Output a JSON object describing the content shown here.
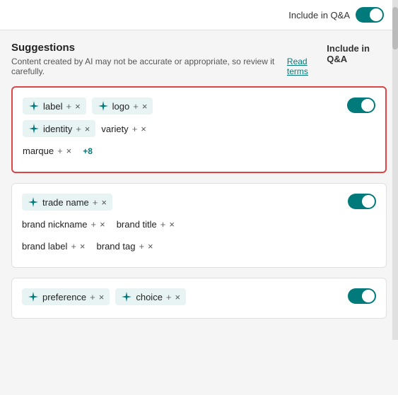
{
  "topbar": {
    "toggle_label": "Include in Q&A",
    "toggle_on": true
  },
  "header": {
    "suggestions_title": "Suggestions",
    "suggestions_sub": "Content created by AI may not be accurate or appropriate, so review it carefully.",
    "read_terms": "Read terms",
    "include_qna": "Include in Q&A"
  },
  "cards": [
    {
      "id": "card1",
      "highlighted": true,
      "toggle_on": true,
      "rows": [
        [
          {
            "type": "ai-tag",
            "text": "label",
            "has_plus": true,
            "has_x": true
          },
          {
            "type": "ai-tag",
            "text": "logo",
            "has_plus": true,
            "has_x": true
          }
        ],
        [
          {
            "type": "ai-tag",
            "text": "identity",
            "has_plus": true,
            "has_x": true
          },
          {
            "type": "plain-tag",
            "text": "variety",
            "has_plus": true,
            "has_x": true
          }
        ],
        [
          {
            "type": "plain-tag",
            "text": "marque",
            "has_plus": true,
            "has_x": true
          },
          {
            "type": "more",
            "text": "+8"
          }
        ]
      ]
    },
    {
      "id": "card2",
      "highlighted": false,
      "toggle_on": true,
      "rows": [
        [
          {
            "type": "ai-tag",
            "text": "trade name",
            "has_plus": true,
            "has_x": true
          }
        ],
        [
          {
            "type": "plain-tag",
            "text": "brand nickname",
            "has_plus": true,
            "has_x": true
          },
          {
            "type": "plain-tag",
            "text": "brand title",
            "has_plus": true,
            "has_x": true
          }
        ],
        [
          {
            "type": "plain-tag",
            "text": "brand label",
            "has_plus": true,
            "has_x": true
          },
          {
            "type": "plain-tag",
            "text": "brand tag",
            "has_plus": true,
            "has_x": true
          }
        ]
      ]
    },
    {
      "id": "card3",
      "highlighted": false,
      "toggle_on": true,
      "rows": [
        [
          {
            "type": "ai-tag",
            "text": "preference",
            "has_plus": true,
            "has_x": true
          },
          {
            "type": "ai-tag",
            "text": "choice",
            "has_plus": true,
            "has_x": true
          }
        ]
      ]
    }
  ],
  "scrollbar": {
    "visible": true
  }
}
